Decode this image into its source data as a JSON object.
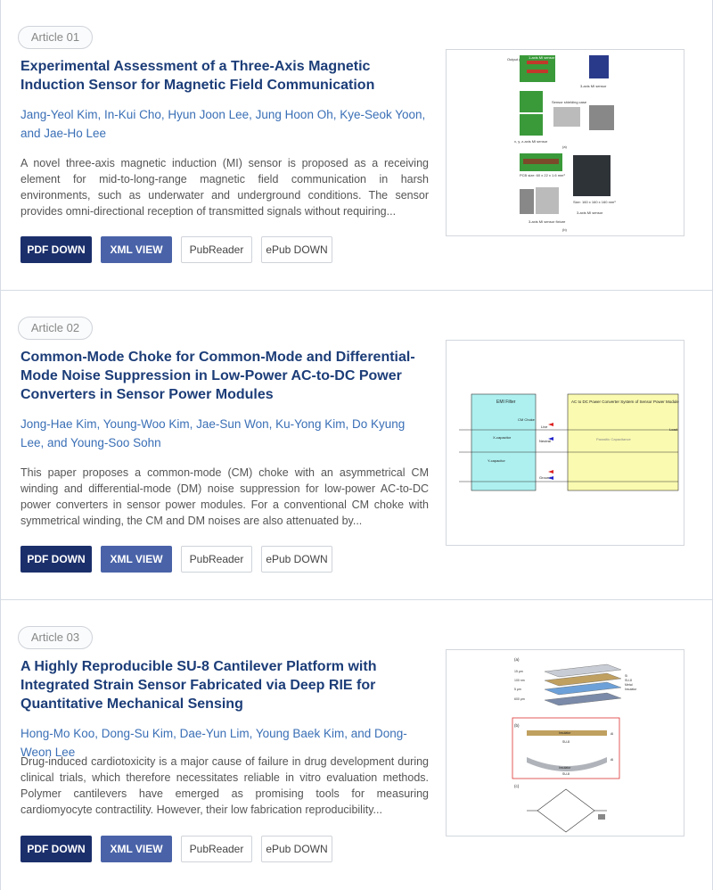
{
  "buttons": {
    "pdf": "PDF DOWN",
    "xml": "XML VIEW",
    "pubreader": "PubReader",
    "epub": "ePub DOWN"
  },
  "articles": [
    {
      "badge": "Article 01",
      "title": "Experimental Assessment of a Three-Axis Magnetic Induction Sensor for Magnetic Field Communication",
      "authors": "Jang-Yeol Kim, In-Kui Cho, Hyun Joon Lee, Jung Hoon Oh, Kye-Seok Yoon, and Jae-Ho Lee",
      "abstract": "A novel three-axis magnetic induction (MI) sensor is proposed as a receiving element for mid-to-long-range magnetic field communication in harsh environments, such as underwater and underground conditions. The sensor provides omni-directional reception of transmitted signals without requiring...",
      "figure": {
        "labels": [
          "Output (port 1)",
          "1-axis MI sensor",
          "3-axis MI sensor",
          "Sensor shielding case",
          "1-axis fixed jig",
          "External shielding case",
          "x, y, z-axis MI sensor",
          "3-axis MI sensor fixture",
          "External shielding case",
          "(a)",
          "PCB size: 60 x 22 x 1.6 mm³",
          "1-axis MI sensor",
          "Size: 160 x 160 x 160 mm³",
          "3-axis MI sensor",
          "3-axis MI sensor fixture",
          "(b)"
        ]
      }
    },
    {
      "badge": "Article 02",
      "title": "Common-Mode Choke for Common-Mode and Differential-Mode Noise Suppression in Low-Power AC-to-DC Power Converters in Sensor Power Modules",
      "authors": "Jong-Hae Kim, Young-Woo Kim, Jae-Sun Won, Ku-Yong Kim, Do Kyung Lee, and Young-Soo Sohn",
      "abstract": "This paper proposes a common-mode (CM) choke with an asymmetrical CM winding and differential-mode (DM) noise suppression for low-power AC-to-DC power converters in sensor power modules. For a conventional CM choke with symmetrical winding, the CM and DM noises are also attenuated by...",
      "figure": {
        "labels": [
          "EMI Filter",
          "AC to DC Power Converter System of Sensor Power Module",
          "CM Choke",
          "X-capacitor",
          "Y-capacitor",
          "Live",
          "Neutral",
          "Ground",
          "Parasitic Capacitance",
          "Load"
        ]
      }
    },
    {
      "badge": "Article 03",
      "title": "A Highly Reproducible SU-8 Cantilever Platform with Integrated Strain Sensor Fabricated via Deep RIE for Quantitative Mechanical Sensing",
      "authors": "Hong-Mo Koo, Dong-Su Kim, Dae-Yun Lim, Young Baek Kim, and Dong-Weon Lee",
      "abstract": "Drug-induced cardiotoxicity is a major cause of failure in drug development during clinical trials, which therefore necessitates reliable in vitro evaluation methods. Polymer cantilevers have emerged as promising tools for measuring cardiomyocyte contractility. However, their low fabrication reproducibility...",
      "figure": {
        "labels": [
          "(a)",
          "15 μm",
          "100 nm",
          "5 μm",
          "600 μm",
          "Si",
          "SU-8",
          "Metal",
          "Insulator",
          "(b)",
          "Insulator",
          "SU-8",
          "Al",
          "Insulator",
          "SU-8",
          "Al",
          "(c)"
        ]
      }
    }
  ]
}
